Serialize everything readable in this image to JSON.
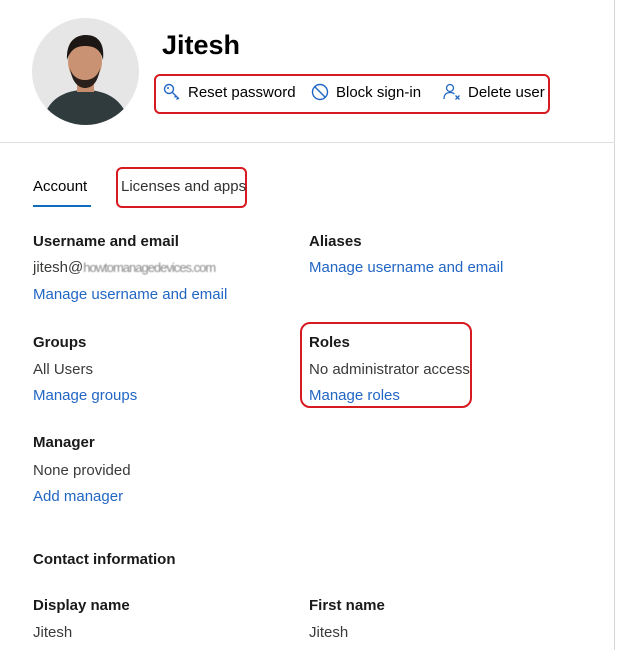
{
  "user": {
    "name": "Jitesh"
  },
  "actions": {
    "reset_password": "Reset password",
    "block_sign_in": "Block sign-in",
    "delete_user": "Delete user"
  },
  "tabs": {
    "account": "Account",
    "licenses": "Licenses and apps"
  },
  "username_email": {
    "label": "Username and email",
    "value_prefix": "jitesh@",
    "value_obscured": "howtomanagedevices.com",
    "link": "Manage username and email"
  },
  "aliases": {
    "label": "Aliases",
    "link": "Manage username and email"
  },
  "groups": {
    "label": "Groups",
    "value": "All Users",
    "link": "Manage groups"
  },
  "roles": {
    "label": "Roles",
    "value": "No administrator access",
    "link": "Manage roles"
  },
  "manager": {
    "label": "Manager",
    "value": "None provided",
    "link": "Add manager"
  },
  "contact": {
    "title": "Contact information",
    "display_name_label": "Display name",
    "display_name_value": "Jitesh",
    "first_name_label": "First name",
    "first_name_value": "Jitesh"
  },
  "colors": {
    "accent": "#0f6cbd",
    "link": "#2266c4",
    "highlight": "#d71920"
  }
}
